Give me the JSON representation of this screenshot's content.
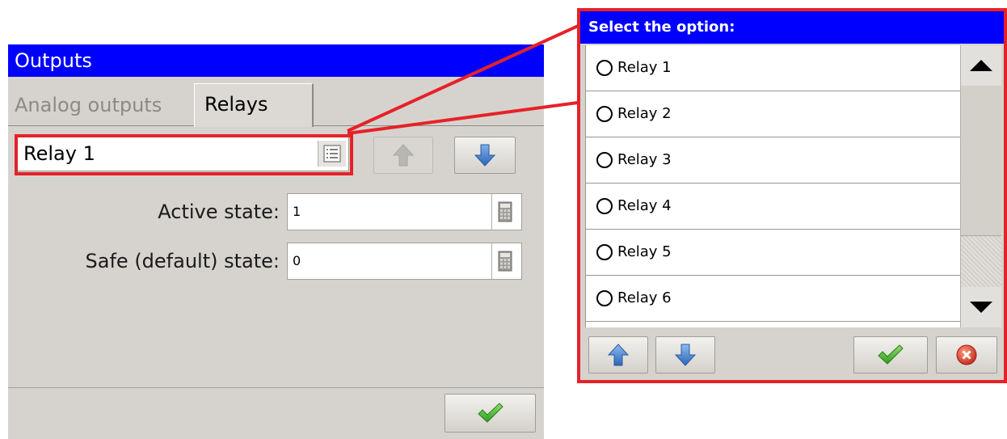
{
  "outputs_window": {
    "title": "Outputs",
    "tabs": [
      {
        "label": "Analog outputs",
        "active": false
      },
      {
        "label": "Relays",
        "active": true
      }
    ],
    "relay_select": {
      "value": "Relay 1",
      "icon": "list-icon"
    },
    "nav": {
      "up_icon": "arrow-up-icon",
      "down_icon": "arrow-down-icon",
      "up_enabled": false
    },
    "fields": [
      {
        "label": "Active state:",
        "value": "1",
        "icon": "calculator-icon"
      },
      {
        "label": "Safe (default) state:",
        "value": "0",
        "icon": "calculator-icon"
      }
    ],
    "ok_icon": "checkmark-icon"
  },
  "select_dialog": {
    "title": "Select the option:",
    "options": [
      "Relay 1",
      "Relay 2",
      "Relay 3",
      "Relay 4",
      "Relay 5",
      "Relay 6"
    ],
    "footer": {
      "up_icon": "arrow-up-icon",
      "down_icon": "arrow-down-icon",
      "ok_icon": "checkmark-icon",
      "cancel_icon": "cancel-icon"
    }
  },
  "colors": {
    "titlebar": "#0000ff",
    "highlight": "#e52228",
    "panel": "#d6d3ce",
    "arrow_blue": "#3a78c8",
    "check_green": "#3fb52b",
    "cancel_red": "#d83a25"
  }
}
